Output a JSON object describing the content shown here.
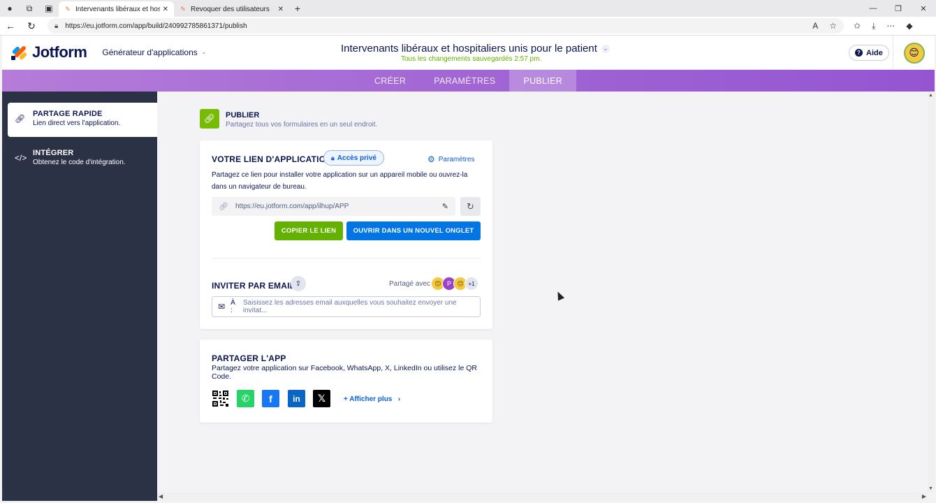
{
  "browser": {
    "tabs": [
      {
        "title": "Intervenants libéraux et hospitalie",
        "active": true
      },
      {
        "title": "Revoquer des utilisateurs",
        "active": false
      }
    ],
    "url": "https://eu.jotform.com/app/build/240992785861371/publish"
  },
  "header": {
    "logo_text": "Jotform",
    "builder_label": "Générateur d'applications",
    "app_title": "Intervenants libéraux et hospitaliers unis pour le patient",
    "saved_status": "Tous les changements sauvegardés 2:57 pm.",
    "help_label": "Aide"
  },
  "nav": {
    "tabs": [
      {
        "label": "CRÉER"
      },
      {
        "label": "PARAMÈTRES"
      },
      {
        "label": "PUBLIER"
      }
    ]
  },
  "sidebar": {
    "items": [
      {
        "title": "PARTAGE RAPIDE",
        "subtitle": "Lien direct vers l'application."
      },
      {
        "title": "INTÉGRER",
        "subtitle": "Obtenez le code d'intégration."
      }
    ]
  },
  "publish": {
    "title": "PUBLIER",
    "subtitle": "Partagez tous vos formulaires en un seul endroit."
  },
  "link_card": {
    "title": "VOTRE LIEN D'APPLICATION",
    "access_badge": "Accès privé",
    "settings_label": "Paramètres",
    "description": "Partagez ce lien pour installer votre application sur un appareil mobile ou ouvrez-la dans un navigateur de bureau.",
    "app_link": "https://eu.jotform.com/app/ilhup/APP",
    "copy_label": "COPIER LE LIEN",
    "open_label": "OUVRIR DANS UN NOUVEL ONGLET",
    "invite_title": "INVITER PAR EMAIL",
    "shared_with": "Partagé avec",
    "shared_avatars": [
      "😊",
      "P",
      "😊",
      "+1"
    ],
    "to_label": "À :",
    "email_placeholder": "Saisissez les adresses email auxquelles vous souhaitez envoyer une invitat..."
  },
  "share_card": {
    "title": "PARTAGER L'APP",
    "description": "Partagez votre application sur Facebook, WhatsApp, X, LinkedIn ou utilisez le QR Code.",
    "more_label": "+ Afficher plus"
  },
  "colors": {
    "green": "#64b200",
    "blue": "#0075e3",
    "navy": "#0a1551",
    "sidebar": "#2b3245",
    "purple": "#a064d4"
  }
}
